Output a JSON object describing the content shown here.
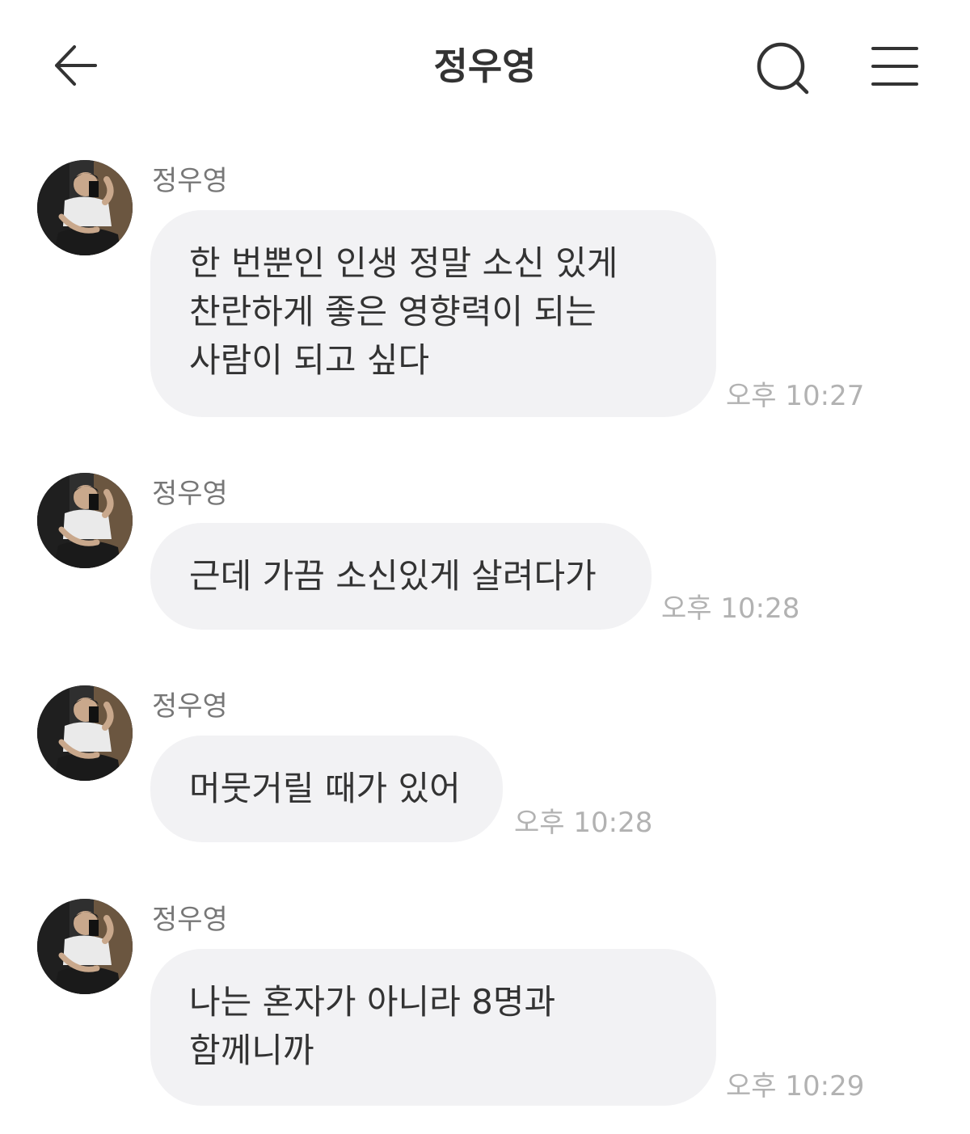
{
  "header": {
    "title": "정우영",
    "back_icon": "arrow-left-icon",
    "search_icon": "search-icon",
    "menu_icon": "hamburger-menu-icon"
  },
  "messages": [
    {
      "sender": "정우영",
      "lines": [
        "한 번뿐인 인생 정말 소신 있게",
        "찬란하게 좋은 영향력이 되는",
        "사람이 되고 싶다"
      ],
      "time": "오후 10:27"
    },
    {
      "sender": "정우영",
      "lines": [
        "근데 가끔 소신있게 살려다가"
      ],
      "time": "오후 10:28"
    },
    {
      "sender": "정우영",
      "lines": [
        "머뭇거릴 때가 있어"
      ],
      "time": "오후 10:28"
    },
    {
      "sender": "정우영",
      "lines": [
        "나는 혼자가 아니라 8명과",
        "함께니까"
      ],
      "time": "오후 10:29"
    }
  ],
  "colors": {
    "bubble": "#f2f2f4",
    "text": "#333333",
    "sender": "#777777",
    "time": "#b2b2b2"
  }
}
